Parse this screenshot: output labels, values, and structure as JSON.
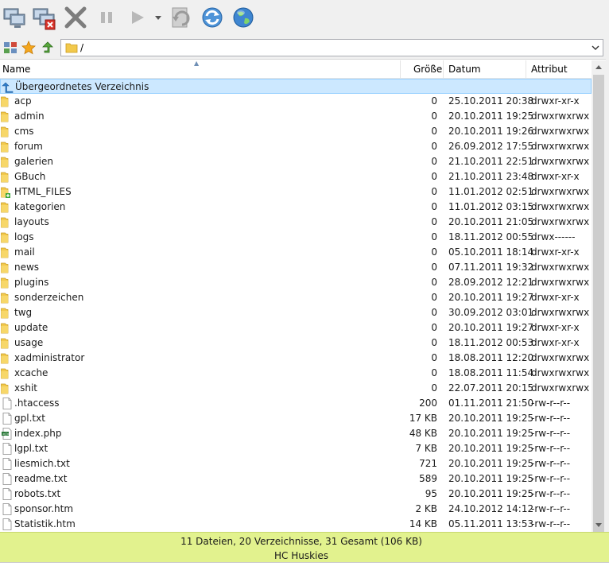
{
  "toolbar": {
    "buttons": [
      {
        "name": "connect-icon"
      },
      {
        "name": "disconnect-icon"
      },
      {
        "name": "cancel-icon"
      },
      {
        "name": "pause-icon"
      },
      {
        "name": "play-icon"
      },
      {
        "name": "dropdown-icon"
      },
      {
        "name": "sync-icon"
      },
      {
        "name": "refresh-icon"
      },
      {
        "name": "globe-icon"
      }
    ]
  },
  "address": {
    "path": "/"
  },
  "columns": {
    "name": "Name",
    "size": "Größe",
    "date": "Datum",
    "attr": "Attribut"
  },
  "rows": [
    {
      "type": "up",
      "name": "Übergeordnetes Verzeichnis",
      "size": "",
      "date": "",
      "attr": ""
    },
    {
      "type": "folder",
      "name": "acp",
      "size": "0",
      "date": "25.10.2011 20:38",
      "attr": "drwxr-xr-x"
    },
    {
      "type": "folder",
      "name": "admin",
      "size": "0",
      "date": "20.10.2011 19:25",
      "attr": "drwxrwxrwx"
    },
    {
      "type": "folder",
      "name": "cms",
      "size": "0",
      "date": "20.10.2011 19:26",
      "attr": "drwxrwxrwx"
    },
    {
      "type": "folder",
      "name": "forum",
      "size": "0",
      "date": "26.09.2012 17:55",
      "attr": "drwxrwxrwx"
    },
    {
      "type": "folder",
      "name": "galerien",
      "size": "0",
      "date": "21.10.2011 22:51",
      "attr": "drwxrwxrwx"
    },
    {
      "type": "folder",
      "name": "GBuch",
      "size": "0",
      "date": "21.10.2011 23:48",
      "attr": "drwxr-xr-x"
    },
    {
      "type": "folder-plus",
      "name": "HTML_FILES",
      "size": "0",
      "date": "11.01.2012 02:51",
      "attr": "drwxrwxrwx"
    },
    {
      "type": "folder",
      "name": "kategorien",
      "size": "0",
      "date": "11.01.2012 03:15",
      "attr": "drwxrwxrwx"
    },
    {
      "type": "folder",
      "name": "layouts",
      "size": "0",
      "date": "20.10.2011 21:05",
      "attr": "drwxrwxrwx"
    },
    {
      "type": "folder",
      "name": "logs",
      "size": "0",
      "date": "18.11.2012 00:55",
      "attr": "drwx------"
    },
    {
      "type": "folder",
      "name": "mail",
      "size": "0",
      "date": "05.10.2011 18:14",
      "attr": "drwxr-xr-x"
    },
    {
      "type": "folder",
      "name": "news",
      "size": "0",
      "date": "07.11.2011 19:32",
      "attr": "drwxrwxrwx"
    },
    {
      "type": "folder",
      "name": "plugins",
      "size": "0",
      "date": "28.09.2012 12:21",
      "attr": "drwxrwxrwx"
    },
    {
      "type": "folder",
      "name": "sonderzeichen",
      "size": "0",
      "date": "20.10.2011 19:27",
      "attr": "drwxr-xr-x"
    },
    {
      "type": "folder",
      "name": "twg",
      "size": "0",
      "date": "30.09.2012 03:01",
      "attr": "drwxrwxrwx"
    },
    {
      "type": "folder",
      "name": "update",
      "size": "0",
      "date": "20.10.2011 19:27",
      "attr": "drwxr-xr-x"
    },
    {
      "type": "folder",
      "name": "usage",
      "size": "0",
      "date": "18.11.2012 00:53",
      "attr": "drwxr-xr-x"
    },
    {
      "type": "folder",
      "name": "xadministrator",
      "size": "0",
      "date": "18.08.2011 12:20",
      "attr": "drwxrwxrwx"
    },
    {
      "type": "folder",
      "name": "xcache",
      "size": "0",
      "date": "18.08.2011 11:54",
      "attr": "drwxrwxrwx"
    },
    {
      "type": "folder",
      "name": "xshit",
      "size": "0",
      "date": "22.07.2011 20:15",
      "attr": "drwxrwxrwx"
    },
    {
      "type": "file",
      "name": ".htaccess",
      "size": "200",
      "date": "01.11.2011 21:50",
      "attr": "-rw-r--r--"
    },
    {
      "type": "file",
      "name": "gpl.txt",
      "size": "17 KB",
      "date": "20.10.2011 19:25",
      "attr": "-rw-r--r--"
    },
    {
      "type": "php",
      "name": "index.php",
      "size": "48 KB",
      "date": "20.10.2011 19:25",
      "attr": "-rw-r--r--"
    },
    {
      "type": "file",
      "name": "lgpl.txt",
      "size": "7 KB",
      "date": "20.10.2011 19:25",
      "attr": "-rw-r--r--"
    },
    {
      "type": "file",
      "name": "liesmich.txt",
      "size": "721",
      "date": "20.10.2011 19:25",
      "attr": "-rw-r--r--"
    },
    {
      "type": "file",
      "name": "readme.txt",
      "size": "589",
      "date": "20.10.2011 19:25",
      "attr": "-rw-r--r--"
    },
    {
      "type": "file",
      "name": "robots.txt",
      "size": "95",
      "date": "20.10.2011 19:25",
      "attr": "-rw-r--r--"
    },
    {
      "type": "file",
      "name": "sponsor.htm",
      "size": "2 KB",
      "date": "24.10.2012 14:12",
      "attr": "-rw-r--r--"
    },
    {
      "type": "file",
      "name": "Statistik.htm",
      "size": "14 KB",
      "date": "05.11.2011 13:53",
      "attr": "-rw-r--r--"
    }
  ],
  "status": {
    "summary": "11 Dateien, 20 Verzeichnisse, 31 Gesamt (106 KB)",
    "site": "HC Huskies"
  },
  "colors": {
    "status_bg": "#e2f28e",
    "selected_bg": "#cce8ff",
    "folder": "#f2c94c"
  }
}
